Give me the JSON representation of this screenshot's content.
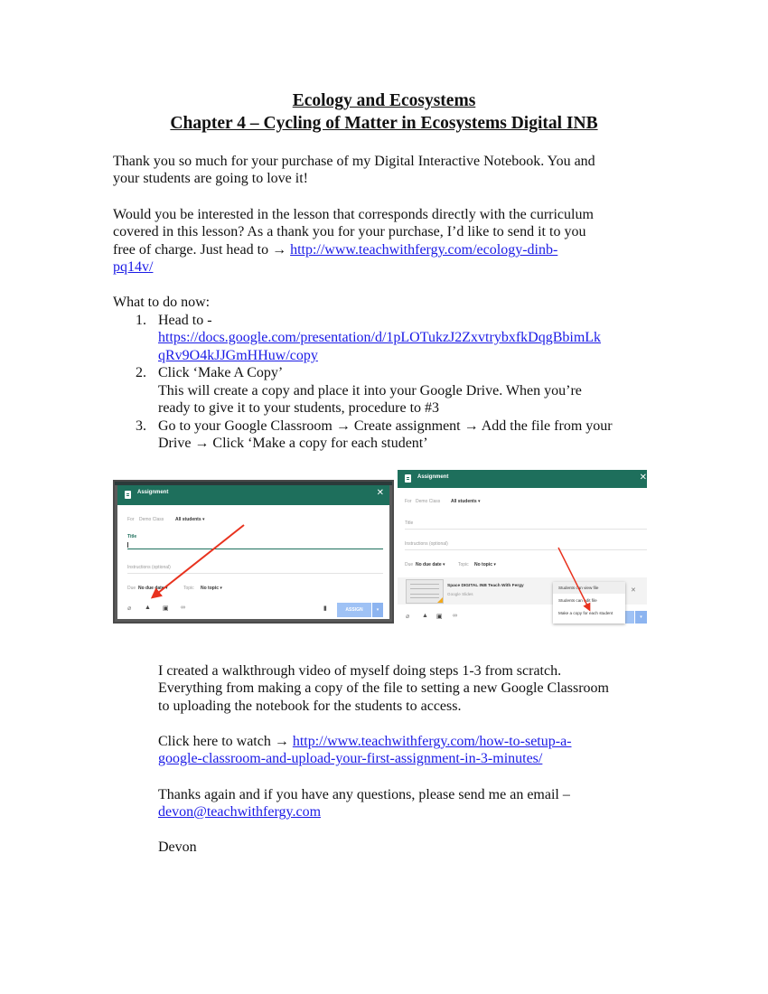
{
  "document": {
    "title_line1": "Ecology and Ecosystems",
    "title_line2": "Chapter 4 – Cycling of Matter in Ecosystems Digital INB",
    "intro": {
      "line1": "Thank you so much for your purchase of my Digital Interactive Notebook. You and",
      "line2": "your students are going to love it!"
    },
    "offer": {
      "line1": "Would you be interested in the lesson that corresponds directly with the curriculum",
      "line2": "covered in this lesson? As a thank you for your purchase, I’d like to send it to you",
      "line3_prefix": "free of charge. Just head to → ",
      "link_part1": "http://www.teachwithfergy.com/ecology-dinb-",
      "link_part2": "pq14v/"
    },
    "steps_heading": "What to do now:",
    "steps": [
      {
        "number": "1.",
        "text": "Head to -",
        "link_part1": "https://docs.google.com/presentation/d/1pLOTukzJ2ZxvtrybxfkDqgBbimLk",
        "link_part2": "qRv9O4kJJGmHHuw/copy"
      },
      {
        "number": "2.",
        "text": "Click ‘Make A Copy’",
        "detail_line1": "This will create a copy and place it into your Google Drive. When you’re",
        "detail_line2": "ready to give it to your students, procedure to #3"
      },
      {
        "number": "3.",
        "text_line1": "Go to your Google Classroom → Create assignment → Add the file from your",
        "text_line2": "Drive → Click ‘Make a copy for each student’"
      }
    ],
    "video": {
      "line1": "I created a walkthrough video of myself doing steps 1-3 from scratch.",
      "line2": "Everything from making a copy of the file to setting a new Google Classroom",
      "line3": "to uploading the notebook for the students to access.",
      "watch_prefix": "Click here to watch → ",
      "link_part1": "http://www.teachwithfergy.com/how-to-setup-a-",
      "link_part2": "google-classroom-and-upload-your-first-assignment-in-3-minutes/"
    },
    "closing": {
      "line1": "Thanks again and if you have any questions, please send me an email –",
      "email": "devon@teachwithfergy.com",
      "signature": "Devon"
    }
  },
  "screenshot1": {
    "header_title": "Assignment",
    "close_icon": "✕",
    "for_label": "For",
    "class_name": "Demo Class",
    "audience": "All students ▾",
    "title_label": "Title",
    "instructions_placeholder": "Instructions (optional)",
    "due_label": "Due",
    "due_value": "No due date ▾",
    "topic_label": "Topic",
    "topic_value": "No topic ▾",
    "assign_button": "ASSIGN",
    "dropdown_arrow": "▾",
    "colors": {
      "header": "#1e6f5c",
      "assign_button": "#9fc2f5",
      "arrow": "#e8321e"
    }
  },
  "screenshot2": {
    "header_title": "Assignment",
    "close_icon": "✕",
    "for_label": "For",
    "class_name": "Demo Class",
    "audience": "All students ▾",
    "title_placeholder": "Title",
    "instructions_placeholder": "Instructions (optional)",
    "due_label": "Due",
    "due_value": "No due date ▾",
    "topic_label": "Topic",
    "topic_value": "No topic ▾",
    "attachment_title": "Space DIGITAL INB Teach With Fergy",
    "attachment_type": "Google Slides",
    "attachment_remove": "✕",
    "menu_options": [
      "Students can view file",
      "Students can edit file",
      "Make a copy for each student"
    ],
    "dropdown_arrow": "▾"
  }
}
